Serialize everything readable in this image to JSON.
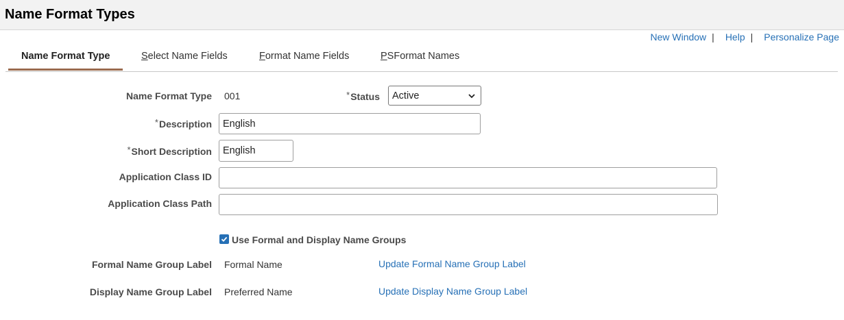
{
  "header": {
    "title": "Name Format Types"
  },
  "toplinks": {
    "new_window": "New Window",
    "help": "Help",
    "personalize": "Personalize Page",
    "sep": "|"
  },
  "tabs": {
    "name_format_type": "Name Format Type",
    "select_name_fields_first": "S",
    "select_name_fields_rest": "elect Name Fields",
    "format_name_fields_first": "F",
    "format_name_fields_rest": "ormat Name Fields",
    "psformat_names_first": "P",
    "psformat_names_rest": "SFormat Names"
  },
  "form": {
    "required_mark": "*",
    "name_format_type_label": "Name Format Type",
    "name_format_type_value": "001",
    "status_label": "Status",
    "status_value": "Active",
    "description_label": "Description",
    "description_value": "English",
    "short_description_label": "Short Description",
    "short_description_value": "English",
    "app_class_id_label": "Application Class ID",
    "app_class_id_value": "",
    "app_class_path_label": "Application Class Path",
    "app_class_path_value": "",
    "use_groups_label": "Use Formal and Display Name Groups",
    "use_groups_checked": true,
    "formal_group_label": "Formal Name Group Label",
    "formal_group_value": "Formal Name",
    "formal_group_link": "Update Formal Name Group Label",
    "display_group_label": "Display Name Group Label",
    "display_group_value": "Preferred Name",
    "display_group_link": "Update Display Name Group Label"
  },
  "colors": {
    "link": "#2670b6",
    "active_tab_underline": "#9a6b4e",
    "checkbox": "#2670b6"
  }
}
